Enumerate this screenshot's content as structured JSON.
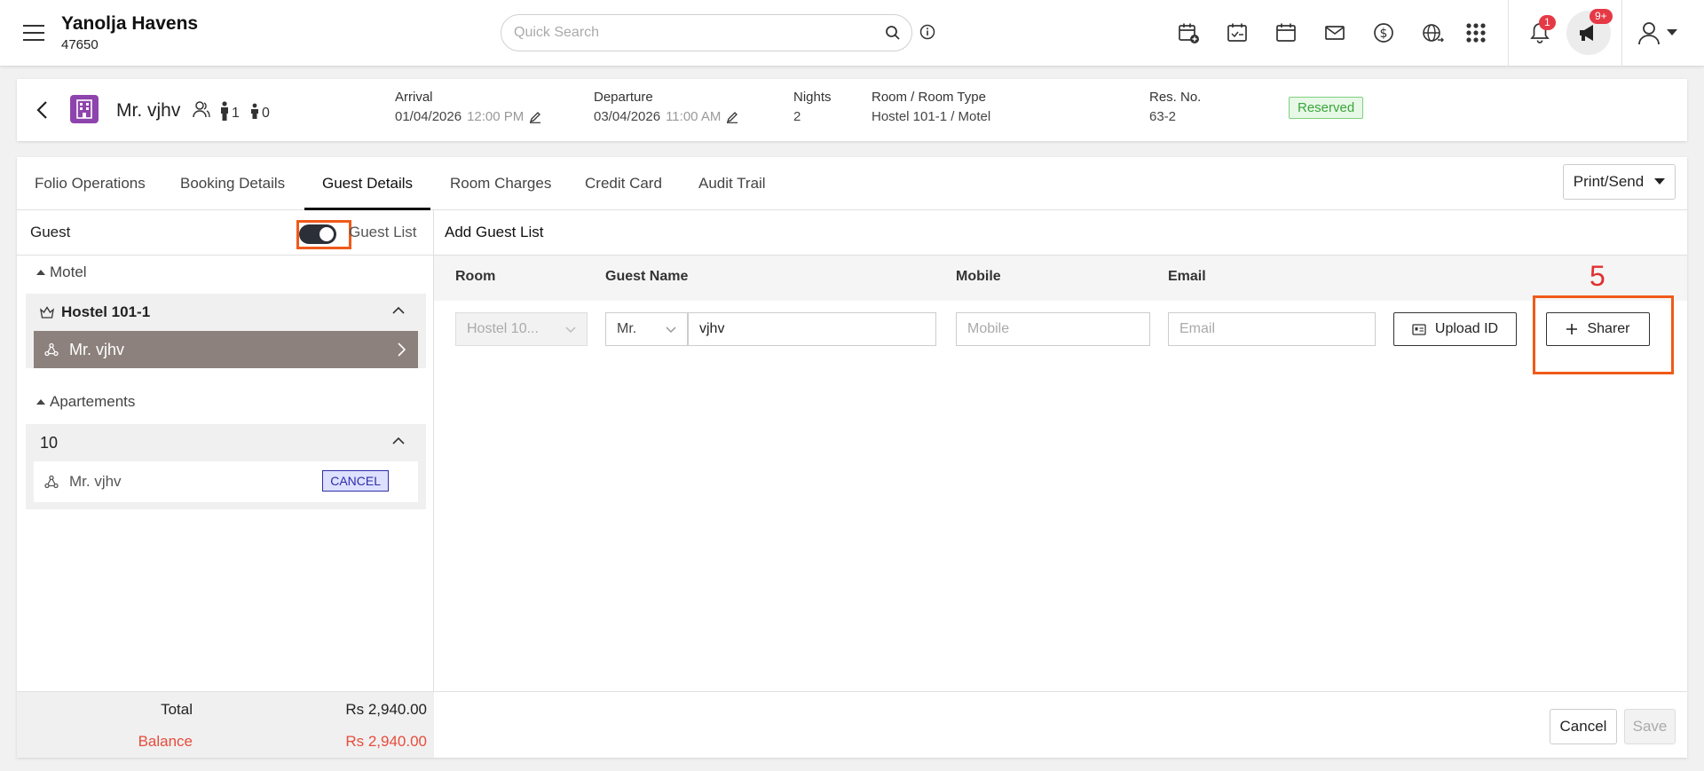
{
  "app": {
    "hotel_name": "Yanolja Havens",
    "hotel_id": "47650",
    "search_placeholder": "Quick Search",
    "notification_count": "1",
    "announcement_count": "9+"
  },
  "reservation": {
    "guest_name": "Mr. vjhv",
    "adults": "1",
    "children": "0",
    "arrival_label": "Arrival",
    "arrival_date": "01/04/2026",
    "arrival_time": "12:00 PM",
    "departure_label": "Departure",
    "departure_date": "03/04/2026",
    "departure_time": "11:00 AM",
    "nights_label": "Nights",
    "nights": "2",
    "room_label": "Room / Room Type",
    "room_value": "Hostel 101-1 / Motel",
    "resno_label": "Res. No.",
    "resno_value": "63-2",
    "status": "Reserved",
    "status_color": "#3aa63a"
  },
  "tabs": [
    {
      "label": "Folio Operations"
    },
    {
      "label": "Booking Details"
    },
    {
      "label": "Guest Details",
      "active": true
    },
    {
      "label": "Room Charges"
    },
    {
      "label": "Credit Card"
    },
    {
      "label": "Audit Trail"
    }
  ],
  "print_send_label": "Print/Send",
  "left_panel": {
    "guest_label": "Guest",
    "guest_list_label": "Guest List",
    "groups": [
      {
        "label": "Motel",
        "room": "Hostel 101-1",
        "guests": [
          {
            "name": "Mr. vjhv",
            "selected": true
          }
        ]
      },
      {
        "label": "Apartements",
        "room": "10",
        "guests": [
          {
            "name": "Mr. vjhv",
            "action": "CANCEL"
          }
        ]
      }
    ],
    "footer": {
      "total_label": "Total",
      "total_value": "Rs 2,940.00",
      "balance_label": "Balance",
      "balance_value": "Rs 2,940.00",
      "balance_color": "#e74c3c"
    }
  },
  "right_panel": {
    "title": "Add Guest List",
    "columns": [
      "Room",
      "Guest Name",
      "Mobile",
      "Email"
    ],
    "row": {
      "room": "Hostel 10...",
      "title": "Mr.",
      "guest_name": "vjhv",
      "mobile_placeholder": "Mobile",
      "email_placeholder": "Email"
    },
    "upload_id_label": "Upload ID",
    "sharer_label": "Sharer",
    "step_annotation": "5",
    "cancel_label": "Cancel",
    "save_label": "Save"
  },
  "accent_colors": {
    "highlight": "#f05a1a",
    "brand": "#8e44ad"
  }
}
